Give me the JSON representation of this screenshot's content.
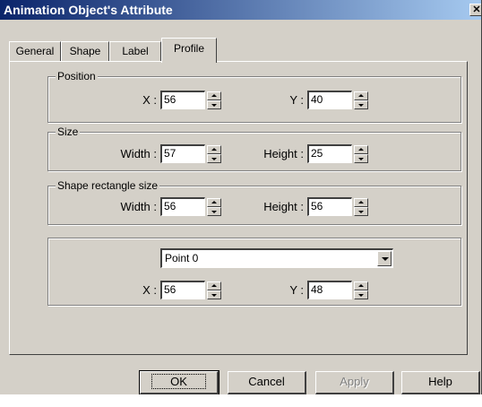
{
  "window": {
    "title": "Animation Object's Attribute",
    "close_glyph": "✕"
  },
  "tabs": [
    {
      "label": "General",
      "active": false
    },
    {
      "label": "Shape",
      "active": false
    },
    {
      "label": "Label",
      "active": false
    },
    {
      "label": "Profile",
      "active": true
    }
  ],
  "position": {
    "title": "Position",
    "x_label": "X :",
    "x_value": "56",
    "y_label": "Y :",
    "y_value": "40"
  },
  "size": {
    "title": "Size",
    "width_label": "Width :",
    "width_value": "57",
    "height_label": "Height :",
    "height_value": "25"
  },
  "shape_rect": {
    "title": "Shape rectangle size",
    "width_label": "Width :",
    "width_value": "56",
    "height_label": "Height :",
    "height_value": "56"
  },
  "points": {
    "selected": "Point 0",
    "x_label": "X :",
    "x_value": "56",
    "y_label": "Y :",
    "y_value": "48"
  },
  "buttons": {
    "ok": "OK",
    "cancel": "Cancel",
    "apply": "Apply",
    "help": "Help"
  }
}
